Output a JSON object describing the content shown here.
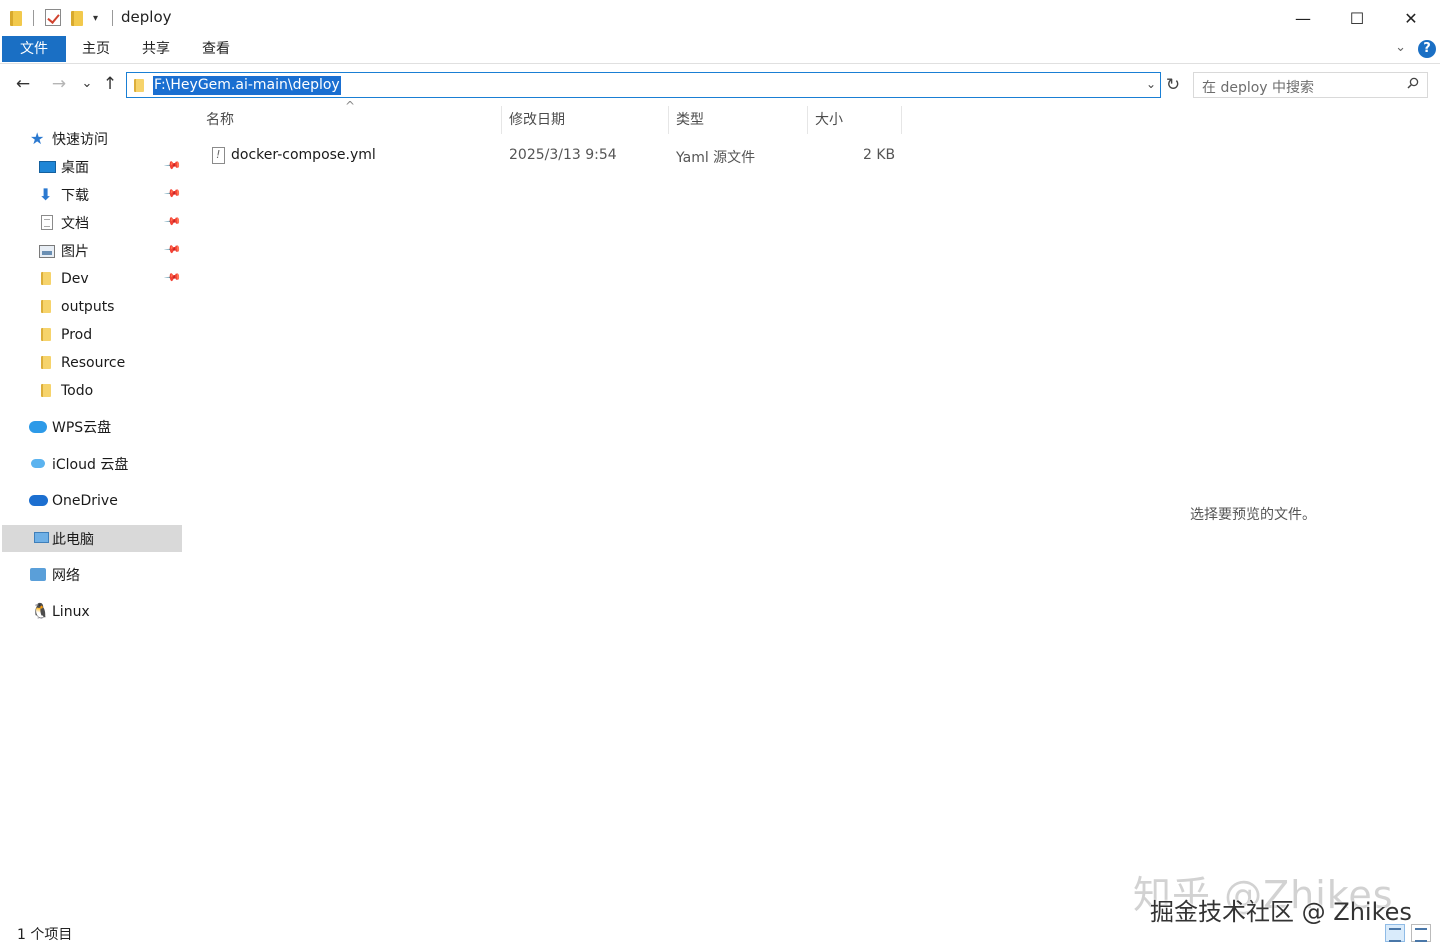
{
  "window": {
    "title": "deploy",
    "quick_access_toolbar": [
      "folder-icon",
      "properties-check-icon",
      "new-folder-icon",
      "customize-dropdown-icon"
    ],
    "controls": {
      "minimize": "—",
      "maximize": "☐",
      "close": "✕"
    }
  },
  "ribbon": {
    "tabs": [
      {
        "label": "文件",
        "active": true
      },
      {
        "label": "主页"
      },
      {
        "label": "共享"
      },
      {
        "label": "查看"
      }
    ],
    "expand_icon": "chevron-down-icon",
    "help": "?"
  },
  "nav": {
    "back": "←",
    "forward": "→",
    "recent": "⌄",
    "up": "↑",
    "address": "F:\\HeyGem.ai-main\\deploy",
    "address_dropdown": "⌄",
    "refresh": "↻",
    "search_placeholder": "在 deploy 中搜索"
  },
  "sidebar": {
    "quick_access": {
      "label": "快速访问",
      "icon": "star-icon"
    },
    "pinned": [
      {
        "label": "桌面",
        "icon": "desktop-icon",
        "pinned": true
      },
      {
        "label": "下载",
        "icon": "download-icon",
        "pinned": true
      },
      {
        "label": "文档",
        "icon": "document-icon",
        "pinned": true
      },
      {
        "label": "图片",
        "icon": "picture-icon",
        "pinned": true
      },
      {
        "label": "Dev",
        "icon": "folder-icon",
        "pinned": true
      },
      {
        "label": "outputs",
        "icon": "folder-icon"
      },
      {
        "label": "Prod",
        "icon": "folder-icon"
      },
      {
        "label": "Resource",
        "icon": "folder-icon"
      },
      {
        "label": "Todo",
        "icon": "folder-icon"
      }
    ],
    "locations": [
      {
        "label": "WPS云盘",
        "icon": "cloud-icon"
      },
      {
        "label": "iCloud 云盘",
        "icon": "icloud-icon"
      },
      {
        "label": "OneDrive",
        "icon": "onedrive-icon"
      },
      {
        "label": "此电脑",
        "icon": "computer-icon",
        "selected": true
      },
      {
        "label": "网络",
        "icon": "network-icon"
      },
      {
        "label": "Linux",
        "icon": "linux-icon"
      }
    ]
  },
  "file_list": {
    "columns": [
      "名称",
      "修改日期",
      "类型",
      "大小"
    ],
    "sort_indicator": "^",
    "rows": [
      {
        "name": "docker-compose.yml",
        "modified": "2025/3/13 9:54",
        "type": "Yaml 源文件",
        "size": "2 KB"
      }
    ]
  },
  "preview_pane": {
    "message": "选择要预览的文件。"
  },
  "status_bar": {
    "item_count": "1 个项目"
  },
  "watermarks": {
    "line1": "知乎 @Zhikes",
    "line2": "掘金技术社区 @ Zhikes"
  },
  "colors": {
    "accent": "#1a6fc4",
    "selection": "#1a6fd1",
    "sidebar_selected": "#d9d9d9"
  }
}
